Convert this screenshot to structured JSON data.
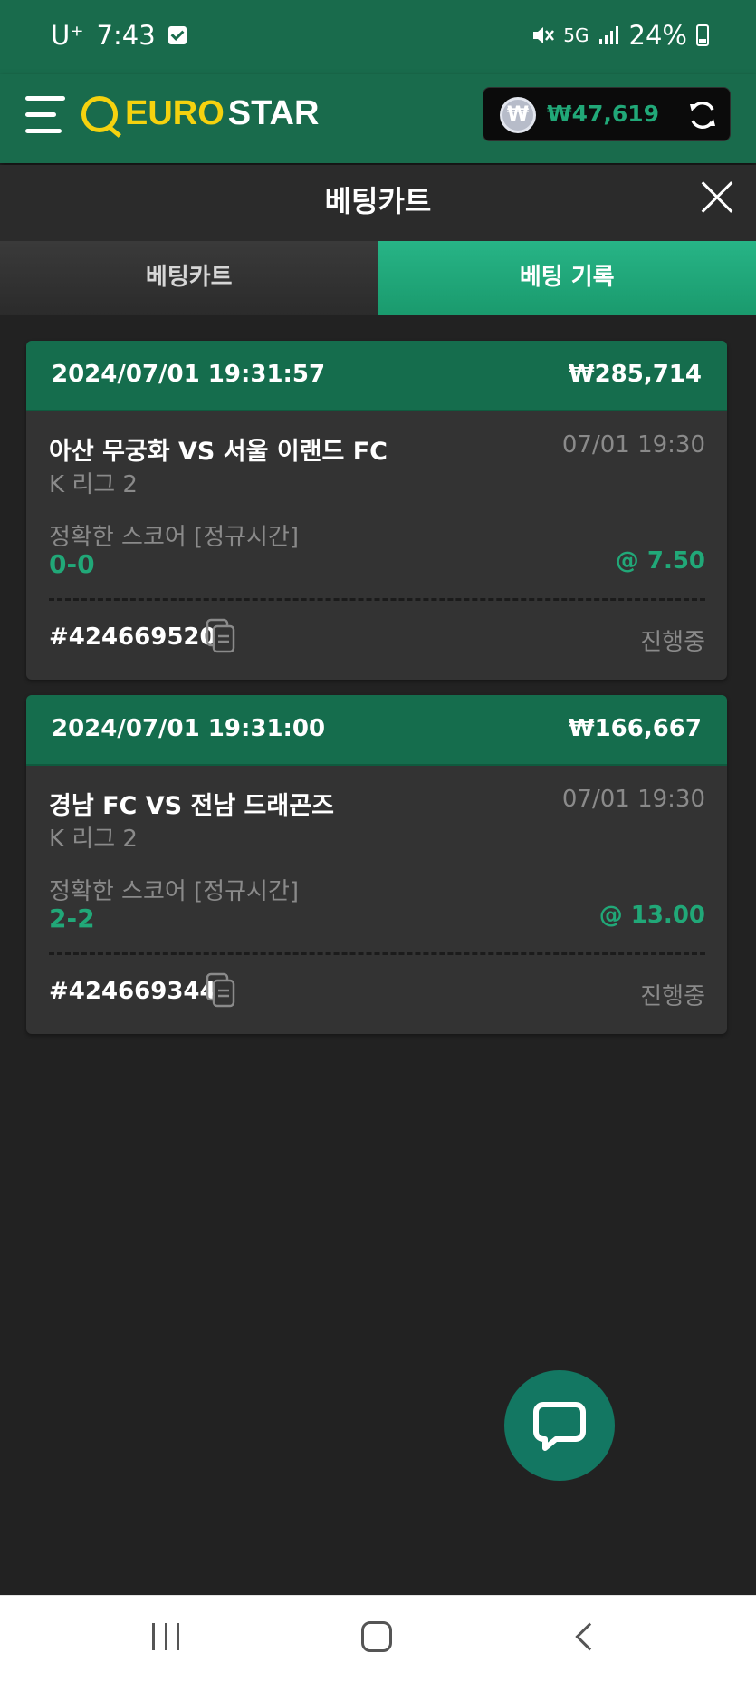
{
  "status_bar": {
    "carrier": "U⁺",
    "time": "7:43",
    "network": "5G",
    "battery": "24%"
  },
  "header": {
    "logo_euro": "EURO",
    "logo_star": "STAR",
    "balance": "₩47,619",
    "currency_symbol": "₩",
    "accent_color": "#196b4c",
    "brand_color": "#f5d20f"
  },
  "panel": {
    "title": "베팅카트",
    "tabs": [
      {
        "label": "베팅카트",
        "active": false
      },
      {
        "label": "베팅 기록",
        "active": true
      }
    ]
  },
  "bets": [
    {
      "placed_at": "2024/07/01 19:31:57",
      "amount": "₩285,714",
      "match": "아산 무궁화 VS 서울 이랜드 FC",
      "match_time": "07/01 19:30",
      "league": "K 리그 2",
      "market": "정확한 스코어 [정규시간]",
      "pick": "0-0",
      "odds": "@ 7.50",
      "ticket": "#4246695205",
      "status": "진행중"
    },
    {
      "placed_at": "2024/07/01 19:31:00",
      "amount": "₩166,667",
      "match": "경남 FC VS 전남 드래곤즈",
      "match_time": "07/01 19:30",
      "league": "K 리그 2",
      "market": "정확한 스코어 [정규시간]",
      "pick": "2-2",
      "odds": "@ 13.00",
      "ticket": "#4246693444",
      "status": "진행중"
    }
  ],
  "icons": {
    "menu": "hamburger-icon",
    "refresh": "refresh-icon",
    "close": "close-icon",
    "copy": "copy-icon",
    "chat": "chat-bubble-icon"
  }
}
